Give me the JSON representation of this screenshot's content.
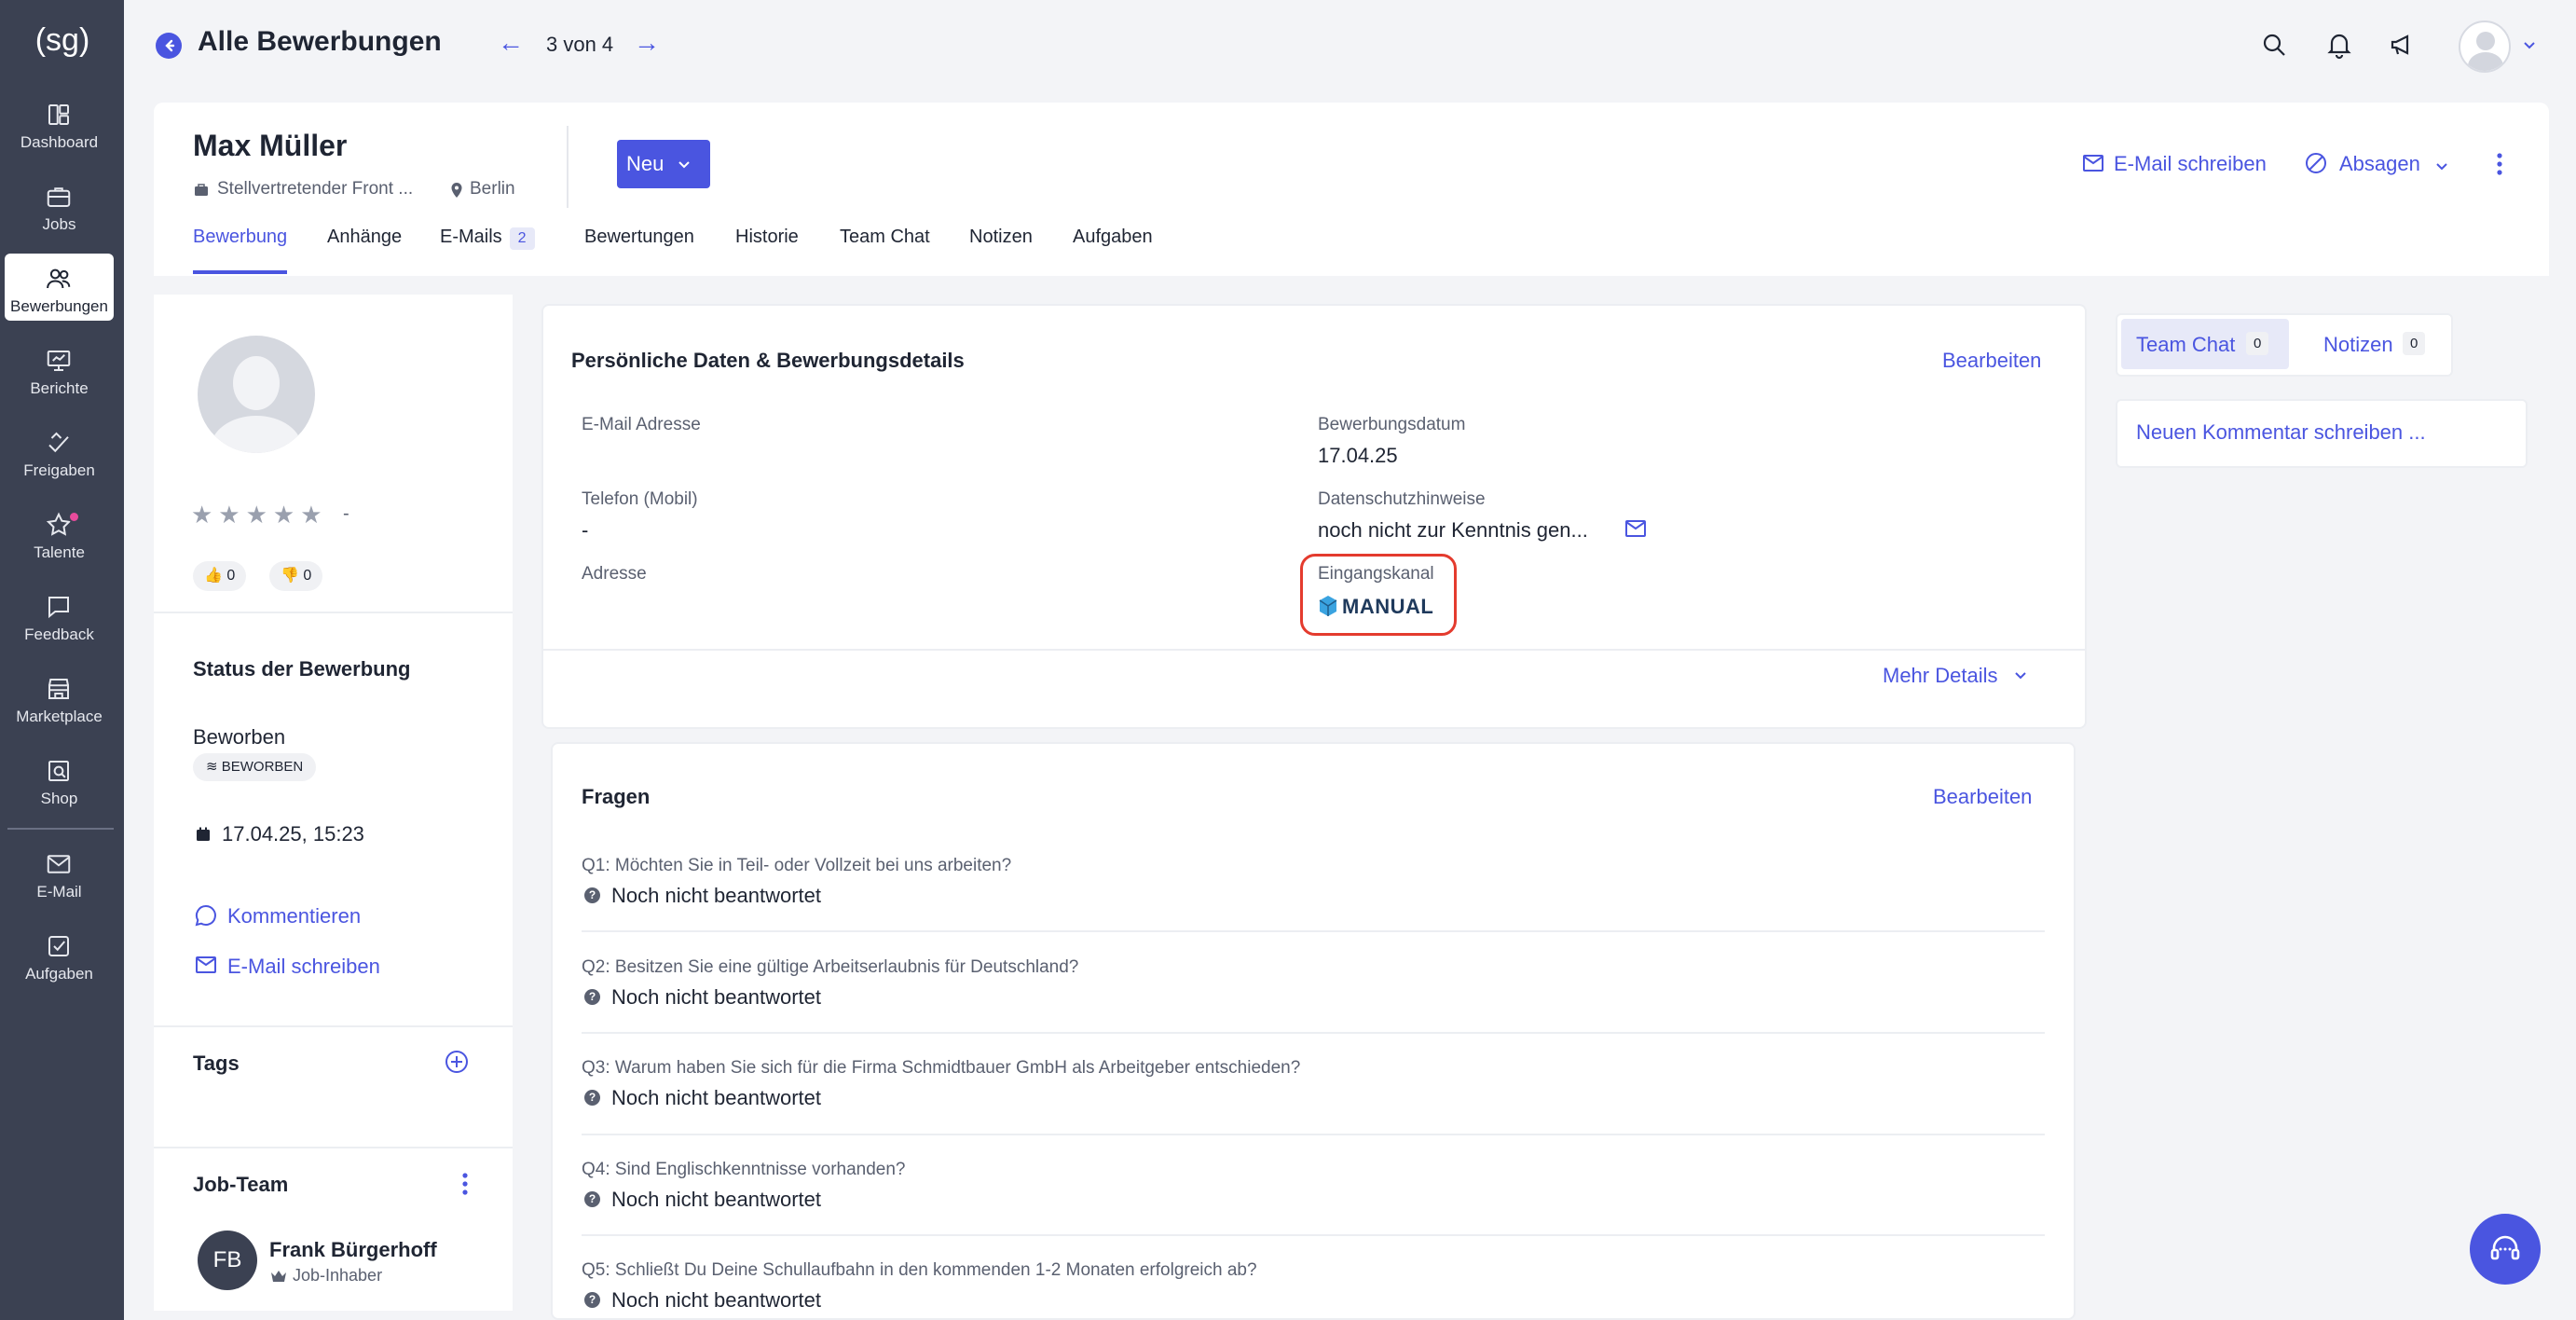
{
  "sidebar": {
    "logo": "(sg)",
    "items": [
      {
        "label": "Dashboard",
        "icon": "dashboard-icon"
      },
      {
        "label": "Jobs",
        "icon": "briefcase-icon"
      },
      {
        "label": "Bewerbungen",
        "icon": "users-icon",
        "active": true
      },
      {
        "label": "Berichte",
        "icon": "presentation-chart-icon"
      },
      {
        "label": "Freigaben",
        "icon": "approval-icon"
      },
      {
        "label": "Talente",
        "icon": "star-icon"
      },
      {
        "label": "Feedback",
        "icon": "chat-icon"
      },
      {
        "label": "Marketplace",
        "icon": "store-icon"
      },
      {
        "label": "Shop",
        "icon": "shop-search-icon"
      },
      {
        "label": "E-Mail",
        "icon": "mail-icon"
      },
      {
        "label": "Aufgaben",
        "icon": "checkbox-icon"
      }
    ]
  },
  "header": {
    "title": "Alle Bewerbungen",
    "pager": "3 von 4",
    "prev": "←",
    "next": "→"
  },
  "candidate": {
    "name": "Max Müller",
    "job": "Stellvertretender Front ...",
    "location": "Berlin",
    "status_button": "Neu",
    "email_action": "E-Mail schreiben",
    "reject_action": "Absagen"
  },
  "tabs": [
    {
      "label": "Bewerbung",
      "active": true
    },
    {
      "label": "Anhänge"
    },
    {
      "label": "E-Mails",
      "badge": "2"
    },
    {
      "label": "Bewertungen"
    },
    {
      "label": "Historie"
    },
    {
      "label": "Team Chat"
    },
    {
      "label": "Notizen"
    },
    {
      "label": "Aufgaben"
    }
  ],
  "profile": {
    "stars": "★★★★★",
    "rating": "-",
    "likes": "0",
    "dislikes": "0",
    "status_title": "Status der Bewerbung",
    "status_main": "Beworben",
    "status_badge": "BEWORBEN",
    "status_date": "17.04.25, 15:23",
    "comment_link": "Kommentieren",
    "email_link": "E-Mail schreiben",
    "tags_title": "Tags",
    "team_title": "Job-Team",
    "member": {
      "initials": "FB",
      "name": "Frank Bürgerhoff",
      "role": "Job-Inhaber"
    }
  },
  "personal": {
    "title": "Persönliche Daten & Bewerbungsdetails",
    "edit": "Bearbeiten",
    "fields": {
      "email_label": "E-Mail Adresse",
      "phone_label": "Telefon (Mobil)",
      "phone_value": "-",
      "address_label": "Adresse",
      "date_label": "Bewerbungsdatum",
      "date_value": "17.04.25",
      "privacy_label": "Datenschutzhinweise",
      "privacy_value": "noch nicht zur Kenntnis gen...",
      "channel_label": "Eingangskanal",
      "channel_value": "MANUAL"
    },
    "more": "Mehr Details"
  },
  "questions": {
    "title": "Fragen",
    "edit": "Bearbeiten",
    "items": [
      {
        "q": "Q1: Möchten Sie in Teil- oder Vollzeit bei uns arbeiten?",
        "a": "Noch nicht beantwortet"
      },
      {
        "q": "Q2: Besitzen Sie eine gültige Arbeitserlaubnis für Deutschland?",
        "a": "Noch nicht beantwortet"
      },
      {
        "q": "Q3: Warum haben Sie sich für die Firma Schmidtbauer GmbH als Arbeitgeber entschieden?",
        "a": "Noch nicht beantwortet"
      },
      {
        "q": "Q4: Sind Englischkenntnisse vorhanden?",
        "a": "Noch nicht beantwortet"
      },
      {
        "q": "Q5: Schließt Du Deine Schullaufbahn in den kommenden 1-2 Monaten erfolgreich ab?",
        "a": "Noch nicht beantwortet"
      }
    ]
  },
  "right_panel": {
    "tab_chat": "Team Chat",
    "tab_chat_count": "0",
    "tab_notes": "Notizen",
    "tab_notes_count": "0",
    "comment_placeholder": "Neuen Kommentar schreiben ..."
  },
  "colors": {
    "accent": "#4a55e0",
    "sidebar": "#3b4152",
    "highlight": "#e43b2e"
  }
}
